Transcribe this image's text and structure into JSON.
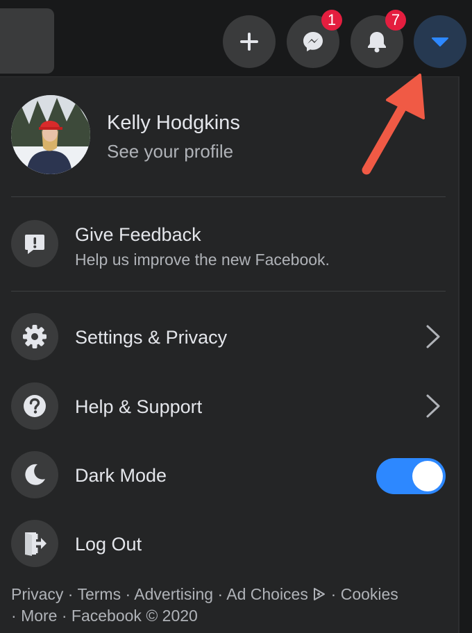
{
  "topbar": {
    "messenger_badge": "1",
    "notifications_badge": "7",
    "icons": [
      "plus-icon",
      "messenger-icon",
      "bell-icon",
      "caret-down-icon"
    ],
    "accent": "#2d88ff"
  },
  "profile": {
    "name": "Kelly Hodgkins",
    "subtitle": "See your profile"
  },
  "feedback": {
    "title": "Give Feedback",
    "description": "Help us improve the new Facebook."
  },
  "menu": {
    "settings_label": "Settings & Privacy",
    "help_label": "Help & Support",
    "dark_mode_label": "Dark Mode",
    "dark_mode_on": true,
    "logout_label": "Log Out"
  },
  "footer": {
    "privacy": "Privacy",
    "terms": "Terms",
    "advertising": "Advertising",
    "ad_choices": "Ad Choices",
    "cookies": "Cookies",
    "more": "More",
    "copyright": "Facebook © 2020",
    "separator": "·"
  },
  "colors": {
    "background": "#18191a",
    "panel": "#242526",
    "badge": "#e41e3f",
    "annotation_arrow": "#f05a45"
  }
}
